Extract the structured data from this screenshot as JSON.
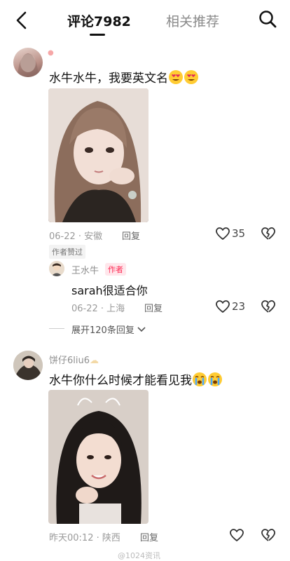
{
  "header": {
    "tab_comments": "评论7982",
    "tab_related": "相关推荐"
  },
  "comments": [
    {
      "text": "水牛水牛，我要英文名",
      "date_location": "06-22 · 安徽",
      "reply_label": "回复",
      "like_count": "35",
      "author_liked": "作者赞过",
      "reply": {
        "username": "王水牛",
        "badge": "作者",
        "text": "sarah很适合你",
        "date_location": "06-22 · 上海",
        "reply_label": "回复",
        "like_count": "23"
      },
      "expand_label": "展开120条回复"
    },
    {
      "username": "饼仔6liu6",
      "text": "水牛你什么时候才能看见我",
      "date_location": "昨天00:12 · 陕西",
      "reply_label": "回复"
    }
  ],
  "watermark": "@1024资讯",
  "icons": [
    "back-icon",
    "search-icon",
    "heart-icon",
    "dislike-icon",
    "chevron-down-icon",
    "emoji-heart-eyes",
    "emoji-crying"
  ],
  "colors": {
    "accent": "#fe2c55",
    "muted": "#9a9a9a"
  }
}
